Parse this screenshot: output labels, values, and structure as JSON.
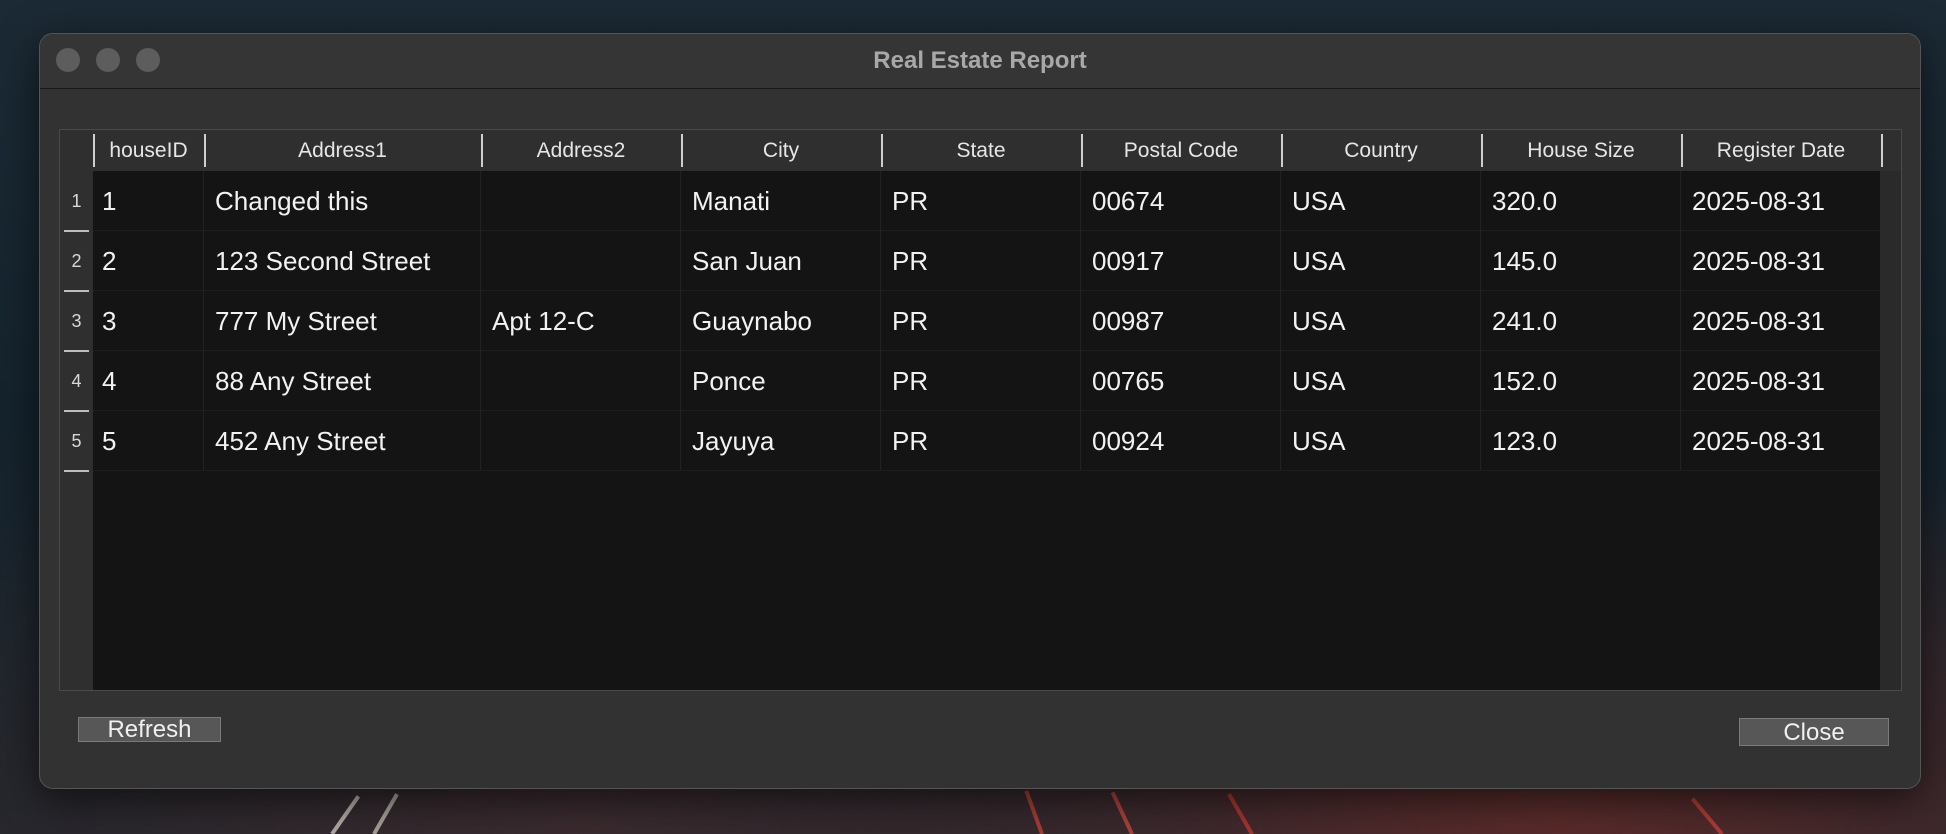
{
  "window": {
    "title": "Real Estate Report"
  },
  "table": {
    "columns": [
      "houseID",
      "Address1",
      "Address2",
      "City",
      "State",
      "Postal Code",
      "Country",
      "House Size",
      "Register Date"
    ],
    "row_numbers": [
      "1",
      "2",
      "3",
      "4",
      "5"
    ],
    "rows": [
      [
        "1",
        "Changed this",
        "",
        "Manati",
        "PR",
        "00674",
        "USA",
        "320.0",
        "2025-08-31"
      ],
      [
        "2",
        "123 Second Street",
        "",
        "San Juan",
        "PR",
        "00917",
        "USA",
        "145.0",
        "2025-08-31"
      ],
      [
        "3",
        "777 My Street",
        "Apt 12-C",
        "Guaynabo",
        "PR",
        "00987",
        "USA",
        "241.0",
        "2025-08-31"
      ],
      [
        "4",
        "88 Any Street",
        "",
        "Ponce",
        "PR",
        "00765",
        "USA",
        "152.0",
        "2025-08-31"
      ],
      [
        "5",
        "452 Any Street",
        "",
        "Jayuya",
        "PR",
        "00924",
        "USA",
        "123.0",
        "2025-08-31"
      ]
    ]
  },
  "buttons": {
    "refresh": "Refresh",
    "close": "Close"
  }
}
